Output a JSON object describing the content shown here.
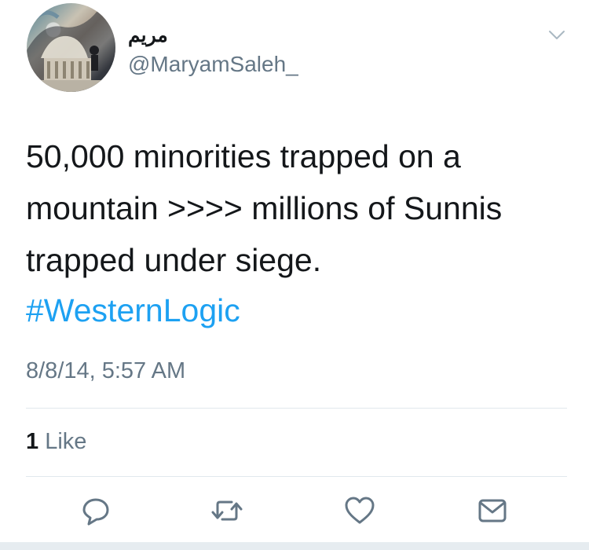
{
  "tweet": {
    "display_name": "مريم",
    "handle": "@MaryamSaleh_",
    "text_line_1": "50,000 minorities trapped on a",
    "text_line_2": "mountain >>>> millions of Sunnis",
    "text_line_3": "trapped under siege.",
    "hashtag": "#WesternLogic",
    "timestamp": "8/8/14, 5:57 AM"
  },
  "stats": {
    "likes_count": "1",
    "likes_label": "Like"
  },
  "actions": {
    "icons": [
      "reply-icon",
      "retweet-icon",
      "like-icon",
      "direct-message-icon"
    ]
  },
  "colors": {
    "link": "#1da1f2",
    "secondary_text": "#657786",
    "icon": "#657786",
    "divider": "#e1e8ed"
  }
}
